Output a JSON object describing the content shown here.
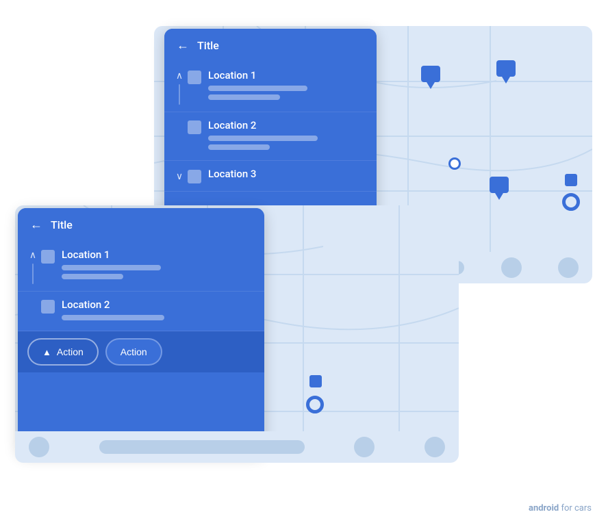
{
  "brand": {
    "label_bold": "android",
    "label_rest": " for cars"
  },
  "back_card": {
    "title": "Title",
    "items": [
      {
        "name": "Location 1",
        "sub1_width": 145,
        "sub2_width": 105,
        "expanded": true
      },
      {
        "name": "Location 2",
        "sub1_width": 160,
        "sub2_width": 90,
        "expanded": false
      },
      {
        "name": "Location 3",
        "sub1_width": 0,
        "sub2_width": 0,
        "expanded": false
      }
    ],
    "back_label": "←",
    "chevron_up": "∧",
    "chevron_down": "∨"
  },
  "front_card": {
    "title": "Title",
    "items": [
      {
        "name": "Location 1",
        "sub1_width": 145,
        "sub2_width": 90,
        "expanded": true
      },
      {
        "name": "Location 2",
        "sub1_width": 150,
        "sub2_width": 0,
        "expanded": false
      }
    ],
    "back_label": "←",
    "chevron_up": "∧",
    "action1": "Action",
    "action2": "Action",
    "action_icon": "▲"
  },
  "nav_bar_back": {
    "circles": 2,
    "pill_width": 280
  },
  "nav_bar_front": {
    "circles": 2,
    "pill_width": 230
  }
}
